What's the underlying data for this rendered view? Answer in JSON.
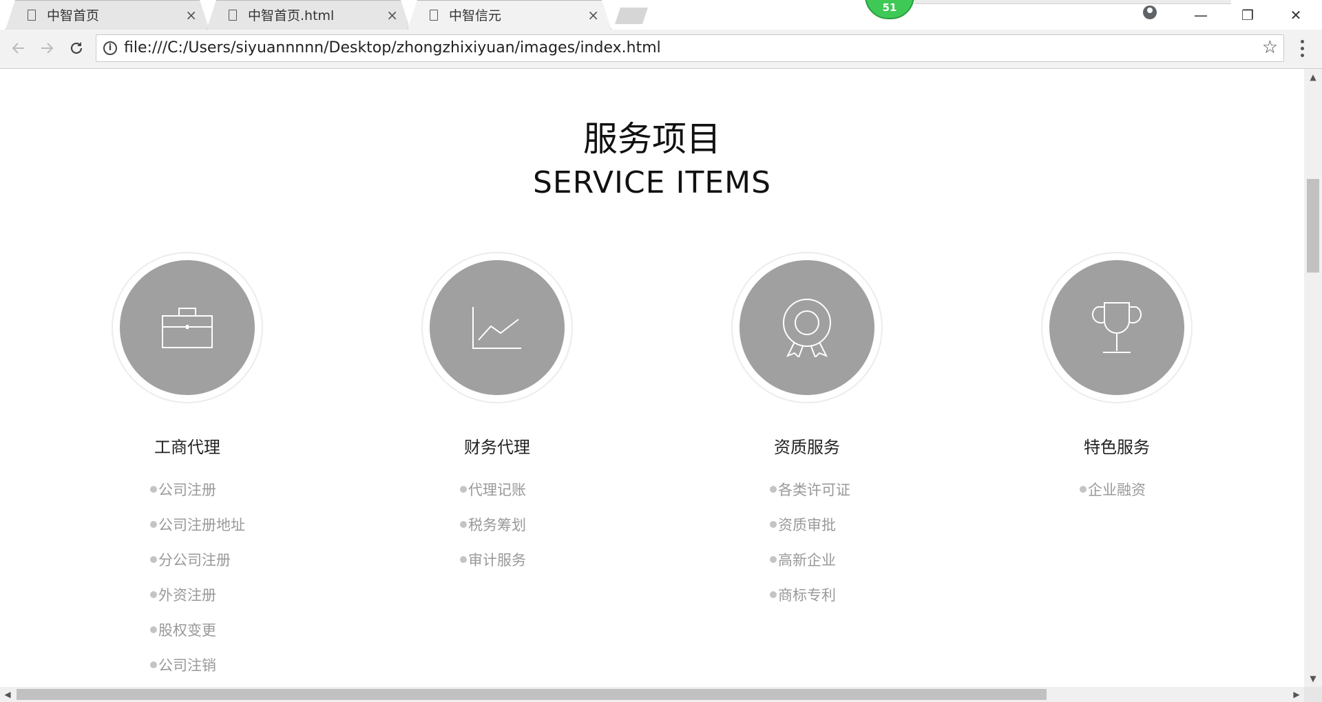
{
  "browser": {
    "tabs": [
      {
        "label": "中智首页",
        "close": "×"
      },
      {
        "label": "中智首页.html",
        "close": "×"
      },
      {
        "label": "中智信元",
        "close": "×"
      }
    ],
    "extension_badge": "51",
    "url": "file:///C:/Users/siyuannnnn/Desktop/zhongzhixiyuan/images/index.html",
    "window_controls": {
      "minimize": "—",
      "restore": "❐",
      "close": "✕"
    }
  },
  "page": {
    "title_cn": "服务项目",
    "title_en": "SERVICE ITEMS",
    "services": [
      {
        "icon": "briefcase-icon",
        "name": "工商代理",
        "items": [
          "公司注册",
          "公司注册地址",
          "分公司注册",
          "外资注册",
          "股权变更",
          "公司注销"
        ]
      },
      {
        "icon": "line-chart-icon",
        "name": "财务代理",
        "items": [
          "代理记账",
          "税务筹划",
          "审计服务"
        ]
      },
      {
        "icon": "award-ribbon-icon",
        "name": "资质服务",
        "items": [
          "各类许可证",
          "资质审批",
          "高新企业",
          "商标专利"
        ]
      },
      {
        "icon": "trophy-icon",
        "name": "特色服务",
        "items": [
          "企业融资"
        ]
      }
    ]
  },
  "colors": {
    "circle": "#a0a0a0",
    "item_text": "#999999",
    "badge": "#3ec957"
  }
}
